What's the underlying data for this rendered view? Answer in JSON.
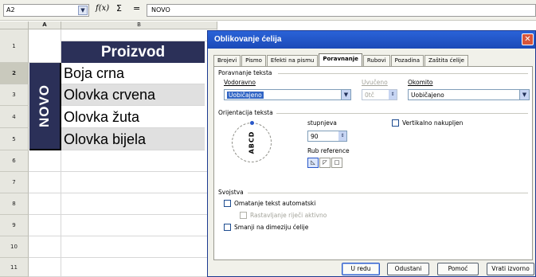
{
  "formula_bar": {
    "cell_ref": "A2",
    "fx": "f(x)",
    "sigma": "Σ",
    "equals": "=",
    "content": "NOVO"
  },
  "sheet": {
    "columns": [
      "A",
      "B"
    ],
    "rows": [
      "1",
      "2",
      "3",
      "4",
      "5",
      "6",
      "7",
      "8",
      "9",
      "10",
      "11"
    ],
    "title": "Proizvod",
    "merged_label": "NOVO",
    "items": [
      "Boja crna",
      "Olovka crvena",
      "Olovka žuta",
      "Olovka bijela"
    ]
  },
  "dialog": {
    "title": "Oblikovanje ćelija",
    "tabs": [
      "Brojevi",
      "Pismo",
      "Efekti na pismu",
      "Poravnanje",
      "Rubovi",
      "Pozadina",
      "Zaštita ćelije"
    ],
    "active_tab": "Poravnanje",
    "text_alignment": {
      "heading": "Poravnanje teksta",
      "horizontal_label": "Vodoravno",
      "horizontal_value": "Uobičajeno",
      "indent_label": "Uvučeno",
      "indent_value": "0tč",
      "vertical_label": "Okomito",
      "vertical_value": "Uobičajeno"
    },
    "orientation": {
      "heading": "Orijentacija teksta",
      "dial_text": "ABCD",
      "degrees_label": "stupnjeva",
      "degrees_value": "90",
      "vertical_stacked_label": "Vertikalno nakupljen",
      "reference_edge_label": "Rub reference"
    },
    "properties": {
      "heading": "Svojstva",
      "wrap_label": "Omatanje tekst automatski",
      "hyphen_label": "Rastavljanje riječi aktivno",
      "shrink_label": "Smanji na dimeziju ćelije"
    },
    "buttons": {
      "ok": "U redu",
      "cancel": "Odustani",
      "help": "Pomoć",
      "reset": "Vrati izvorno"
    }
  }
}
